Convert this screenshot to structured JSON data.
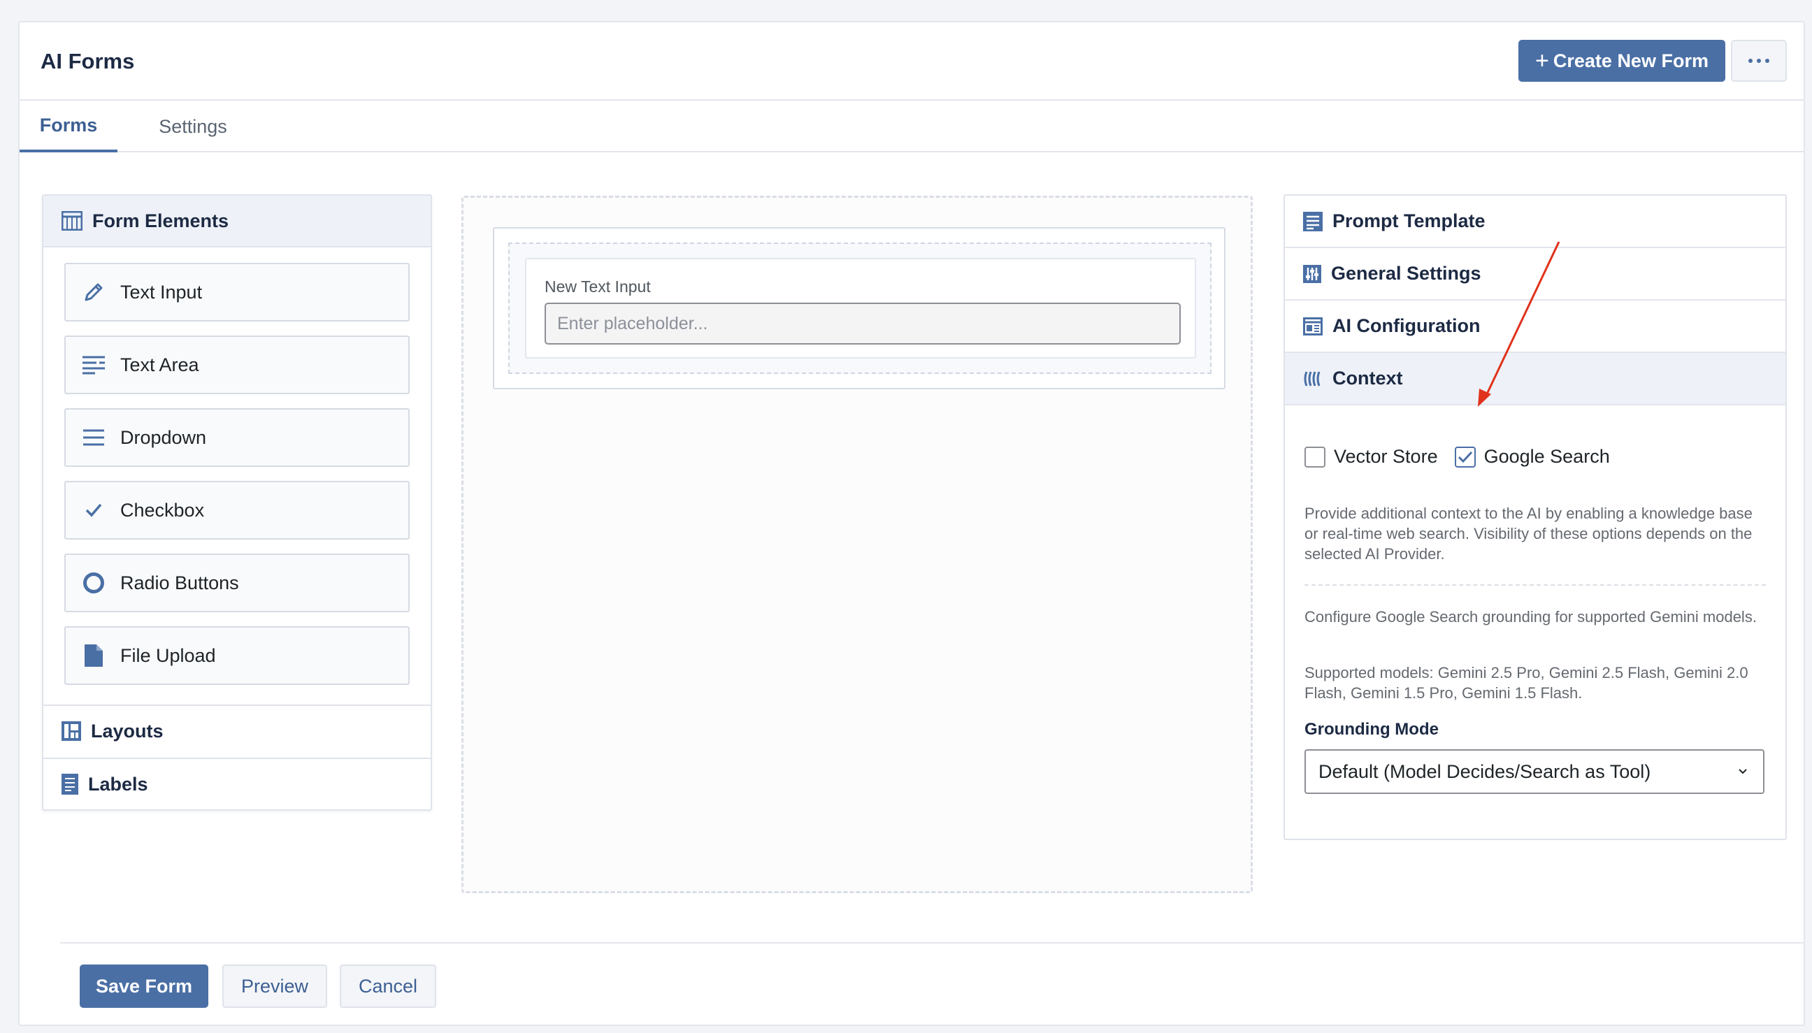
{
  "header": {
    "title": "AI Forms",
    "create_button": "Create New Form"
  },
  "tabs": [
    {
      "label": "Forms",
      "active": true
    },
    {
      "label": "Settings",
      "active": false
    }
  ],
  "left_panel": {
    "title": "Form Elements",
    "elements": [
      {
        "label": "Text Input",
        "icon": "pencil-icon"
      },
      {
        "label": "Text Area",
        "icon": "text-area-icon"
      },
      {
        "label": "Dropdown",
        "icon": "dropdown-icon"
      },
      {
        "label": "Checkbox",
        "icon": "checkmark-icon"
      },
      {
        "label": "Radio Buttons",
        "icon": "radio-icon"
      },
      {
        "label": "File Upload",
        "icon": "file-icon"
      }
    ],
    "sections": [
      {
        "label": "Layouts",
        "icon": "layouts-icon"
      },
      {
        "label": "Labels",
        "icon": "labels-icon"
      }
    ]
  },
  "canvas": {
    "field": {
      "label": "New Text Input",
      "placeholder": "Enter placeholder..."
    }
  },
  "right_panel": {
    "sections": [
      {
        "label": "Prompt Template",
        "icon": "prompt-template-icon"
      },
      {
        "label": "General Settings",
        "icon": "general-settings-icon"
      },
      {
        "label": "AI Configuration",
        "icon": "ai-configuration-icon"
      },
      {
        "label": "Context",
        "icon": "context-icon",
        "active": true
      }
    ],
    "context": {
      "vector_store": {
        "label": "Vector Store",
        "checked": false
      },
      "google_search": {
        "label": "Google Search",
        "checked": true
      },
      "description": "Provide additional context to the AI by enabling a knowledge base or real-time web search. Visibility of these options depends on the selected AI Provider.",
      "grounding_info": "Configure Google Search grounding for supported Gemini models.",
      "supported_models": "Supported models: Gemini 2.5 Pro, Gemini 2.5 Flash, Gemini 2.0 Flash, Gemini 1.5 Pro, Gemini 1.5 Flash.",
      "grounding_mode_label": "Grounding Mode",
      "grounding_mode_value": "Default (Model Decides/Search as Tool)"
    }
  },
  "footer": {
    "save": "Save Form",
    "preview": "Preview",
    "cancel": "Cancel"
  },
  "colors": {
    "accent": "#4a6fa5",
    "annotation_arrow": "#e0321c"
  }
}
